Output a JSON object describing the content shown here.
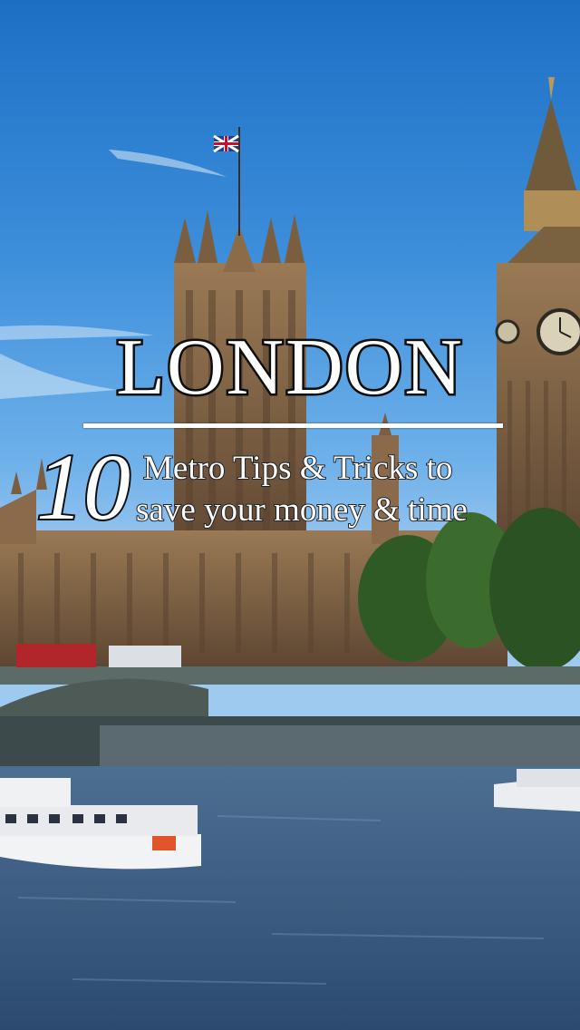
{
  "title": "LONDON",
  "subtitle": {
    "number": "10",
    "line1": "Metro Tips & Tricks to",
    "line2": "save your money & time"
  },
  "colors": {
    "sky_top": "#1c6fc4",
    "stone": "#8a6a4a",
    "river": "#3b5f86",
    "text": "#ffffff",
    "outline": "#111111"
  },
  "icons": [
    "union-jack-flag-icon",
    "big-ben-clock-icon"
  ]
}
